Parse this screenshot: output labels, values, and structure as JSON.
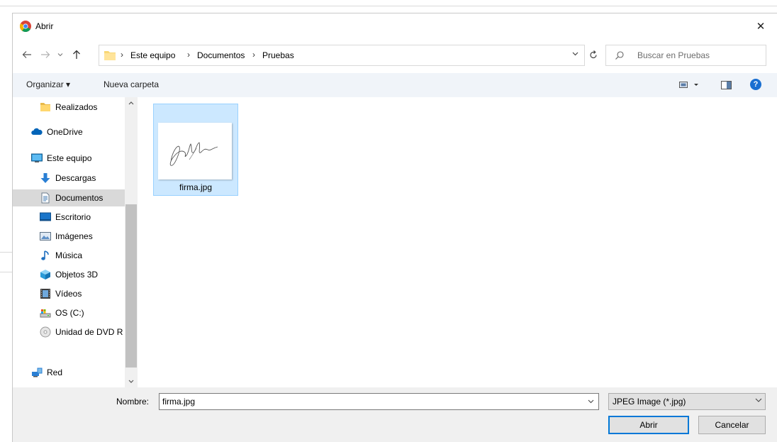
{
  "dialog": {
    "title": "Abrir",
    "close_glyph": "✕"
  },
  "address": {
    "crumbs": [
      "Este equipo",
      "Documentos",
      "Pruebas"
    ],
    "search_placeholder": "Buscar en Pruebas"
  },
  "toolbar": {
    "organize_label": "Organizar ▾",
    "new_folder_label": "Nueva carpeta",
    "help_glyph": "?"
  },
  "nav": {
    "items": [
      {
        "label": "Realizados",
        "icon": "folder-icon"
      },
      {
        "label": "OneDrive",
        "icon": "cloud-icon"
      },
      {
        "label": "Este equipo",
        "icon": "computer-icon"
      },
      {
        "label": "Descargas",
        "icon": "download-icon"
      },
      {
        "label": "Documentos",
        "icon": "document-icon",
        "selected": true
      },
      {
        "label": "Escritorio",
        "icon": "desktop-icon"
      },
      {
        "label": "Imágenes",
        "icon": "pictures-icon"
      },
      {
        "label": "Música",
        "icon": "music-icon"
      },
      {
        "label": "Objetos 3D",
        "icon": "3d-objects-icon"
      },
      {
        "label": "Vídeos",
        "icon": "videos-icon"
      },
      {
        "label": "OS (C:)",
        "icon": "drive-icon"
      },
      {
        "label": "Unidad de DVD R",
        "icon": "dvd-icon"
      },
      {
        "label": "Red",
        "icon": "network-icon"
      }
    ]
  },
  "files": [
    {
      "name": "firma.jpg",
      "selected": true
    }
  ],
  "bottom": {
    "name_label": "Nombre:",
    "file_name_value": "firma.jpg",
    "file_type_value": "JPEG Image (*.jpg)",
    "open_button": "Abrir",
    "cancel_button": "Cancelar"
  },
  "colors": {
    "selection_bg": "#cce8ff",
    "selection_border": "#99d1ff",
    "accent": "#0078d7",
    "toolbar_bg": "#f0f4f9",
    "footer_bg": "#f0f0f0"
  }
}
